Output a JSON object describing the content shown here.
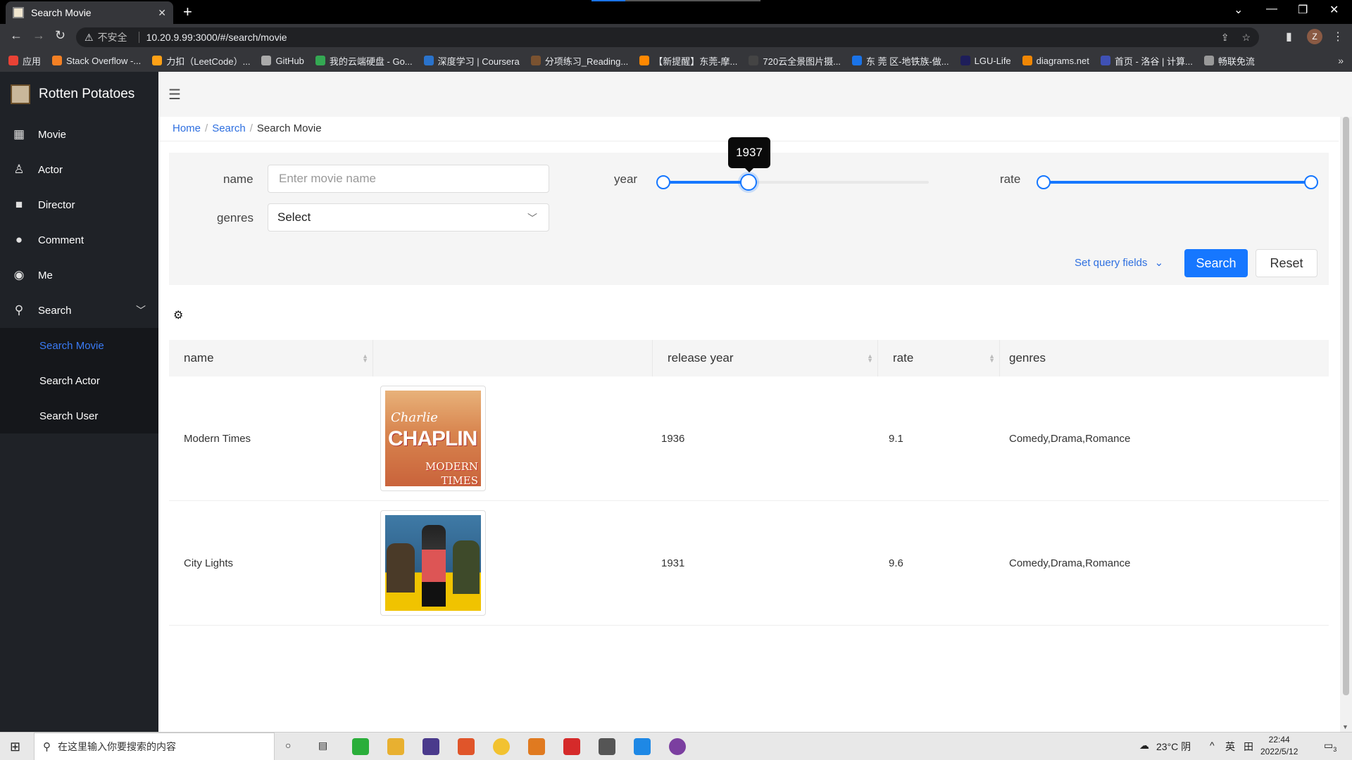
{
  "browser": {
    "tab_title": "Search Movie",
    "address_warning": "不安全",
    "url": "10.20.9.99:3000/#/search/movie",
    "profile_initial": "Z",
    "bookmarks": [
      {
        "label": "应用",
        "color": "#e94235"
      },
      {
        "label": "Stack Overflow -...",
        "color": "#f48024"
      },
      {
        "label": "力扣（LeetCode）...",
        "color": "#ffa116"
      },
      {
        "label": "GitHub",
        "color": "#aaaaaa"
      },
      {
        "label": "我的云端硬盘 - Go...",
        "color": "#34a853"
      },
      {
        "label": "深度学习 | Coursera",
        "color": "#2a73cc"
      },
      {
        "label": "分项练习_Reading...",
        "color": "#7a5230"
      },
      {
        "label": "【新提醒】东莞-摩...",
        "color": "#ff8800"
      },
      {
        "label": "720云全景图片摄...",
        "color": "#444444"
      },
      {
        "label": "东 莞 区-地铁族-做...",
        "color": "#1a73e8"
      },
      {
        "label": "LGU-Life",
        "color": "#1e1e5a"
      },
      {
        "label": "diagrams.net",
        "color": "#f08705"
      },
      {
        "label": "首页 - 洛谷 | 计算...",
        "color": "#3f51b5"
      },
      {
        "label": "畅联免流",
        "color": "#999999"
      }
    ]
  },
  "app": {
    "title": "Rotten Potatoes",
    "menu": [
      {
        "label": "Movie",
        "icon": "film-icon"
      },
      {
        "label": "Actor",
        "icon": "person-icon"
      },
      {
        "label": "Director",
        "icon": "video-camera-icon"
      },
      {
        "label": "Comment",
        "icon": "chat-icon"
      },
      {
        "label": "Me",
        "icon": "user-circle-icon"
      },
      {
        "label": "Search",
        "icon": "search-icon"
      }
    ],
    "submenu": [
      {
        "label": "Search Movie",
        "active": true
      },
      {
        "label": "Search Actor",
        "active": false
      },
      {
        "label": "Search User",
        "active": false
      }
    ]
  },
  "breadcrumb": [
    "Home",
    "Search",
    "Search Movie"
  ],
  "query": {
    "name_label": "name",
    "name_placeholder": "Enter movie name",
    "genres_label": "genres",
    "genres_value": "Select",
    "year_label": "year",
    "year_tooltip": "1937",
    "year_range_fraction": [
      0.0,
      0.32
    ],
    "rate_label": "rate",
    "rate_range_fraction": [
      0.0,
      1.0
    ],
    "set_query_fields": "Set query fields",
    "search_button": "Search",
    "reset_button": "Reset"
  },
  "table": {
    "columns": [
      "name",
      "",
      "release year",
      "rate",
      "genres"
    ],
    "rows": [
      {
        "name": "Modern Times",
        "poster": "modern-times-poster",
        "poster_text": [
          "Charlie",
          "CHAPLIN",
          "MODERN",
          "TIMES"
        ],
        "year": "1936",
        "rate": "9.1",
        "genres": "Comedy,Drama,Romance"
      },
      {
        "name": "City Lights",
        "poster": "city-lights-poster",
        "year": "1931",
        "rate": "9.6",
        "genres": "Comedy,Drama,Romance"
      }
    ]
  },
  "taskbar": {
    "search_placeholder": "在这里输入你要搜索的内容",
    "weather": "23°C 阴",
    "ime": "英",
    "time": "22:44",
    "date": "2022/5/12",
    "notifications": "3"
  },
  "colors": {
    "accent": "#1677ff",
    "sidebar_bg": "#1f2227",
    "active_menu": "#3a7bf6"
  }
}
